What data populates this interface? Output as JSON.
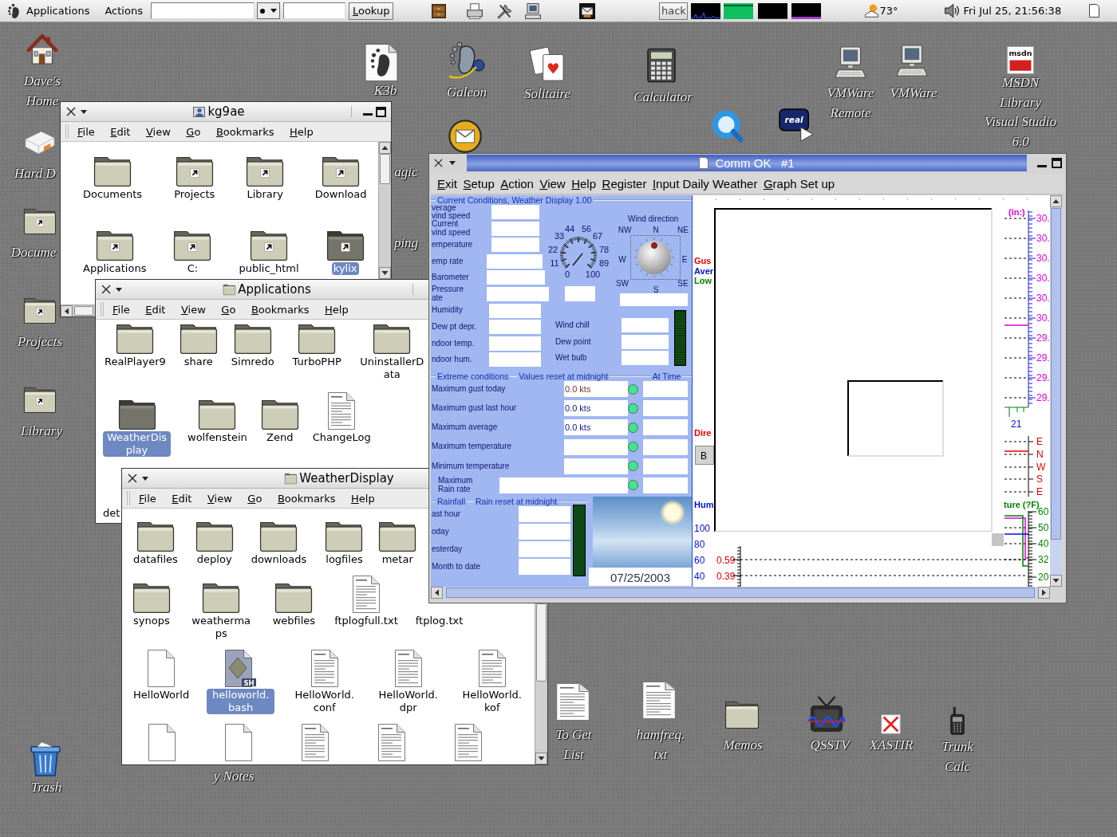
{
  "top_panel": {
    "menus": [
      "Applications",
      "Actions"
    ],
    "lookup_button": "Lookup",
    "hack_button": "hack",
    "temperature": "73°",
    "clock": "Fri Jul 25, 21:56:38"
  },
  "desktop_icons": [
    {
      "label": "Dave's Home",
      "kind": "home"
    },
    {
      "label": "Hard D",
      "kind": "drive"
    },
    {
      "label": "Docume",
      "kind": "folder-link"
    },
    {
      "label": "Projects",
      "kind": "folder-link"
    },
    {
      "label": "Library",
      "kind": "folder-link"
    },
    {
      "label": "Trash",
      "kind": "trash"
    },
    {
      "label": "K3b",
      "kind": "footprint-doc"
    },
    {
      "label": "Galeon",
      "kind": "footprint"
    },
    {
      "label": "Solitaire",
      "kind": "cards"
    },
    {
      "label": "Calculator",
      "kind": "calculator"
    },
    {
      "label": "VMWare Remote",
      "kind": "computer"
    },
    {
      "label": "VMWare",
      "kind": "computer"
    },
    {
      "label": "MSDN Library Visual Studio 6.0",
      "kind": "logo",
      "badge": "msdn"
    },
    {
      "kind": "envelope"
    },
    {
      "kind": "ring"
    },
    {
      "kind": "player",
      "badge": "real"
    },
    {
      "label": "agic",
      "kind": "covered"
    },
    {
      "label": "ping",
      "kind": "covered"
    },
    {
      "label": "To Get List",
      "kind": "document"
    },
    {
      "label": "hamfreq.txt",
      "kind": "document"
    },
    {
      "label": "Memos",
      "kind": "folder"
    },
    {
      "label": "QSSTV",
      "kind": "tv"
    },
    {
      "label": "XASTIR",
      "kind": "cross"
    },
    {
      "label": "Trunk Calc",
      "kind": "radio"
    },
    {
      "label": "y Notes",
      "kind": "covered"
    }
  ],
  "file_windows": [
    {
      "title": "kg9ae",
      "menus": [
        "File",
        "Edit",
        "View",
        "Go",
        "Bookmarks",
        "Help"
      ],
      "items": [
        {
          "label": "Documents",
          "kind": "folder",
          "selected": false
        },
        {
          "label": "Projects",
          "kind": "folder-link",
          "selected": false
        },
        {
          "label": "Library",
          "kind": "folder-link",
          "selected": false
        },
        {
          "label": "Download",
          "kind": "folder-link",
          "selected": false
        },
        {
          "label": "Applications",
          "kind": "folder-link",
          "selected": false
        },
        {
          "label": "C:",
          "kind": "folder-link",
          "selected": false
        },
        {
          "label": "public_html",
          "kind": "folder-link",
          "selected": false
        },
        {
          "label": "kylix",
          "kind": "folder-link",
          "selected": true
        }
      ]
    },
    {
      "title": "Applications",
      "menus": [
        "File",
        "Edit",
        "View",
        "Go",
        "Bookmarks",
        "Help"
      ],
      "items": [
        {
          "label": "RealPlayer9",
          "kind": "folder",
          "selected": false
        },
        {
          "label": "share",
          "kind": "folder",
          "selected": false
        },
        {
          "label": "Simredo",
          "kind": "folder",
          "selected": false
        },
        {
          "label": "TurboPHP",
          "kind": "folder",
          "selected": false
        },
        {
          "label": "UninstallerData",
          "kind": "folder",
          "selected": false
        },
        {
          "label": "WeatherDisplay",
          "kind": "folder",
          "selected": true
        },
        {
          "label": "wolfenstein",
          "kind": "folder",
          "selected": false
        },
        {
          "label": "Zend",
          "kind": "folder",
          "selected": false
        },
        {
          "label": "ChangeLog",
          "kind": "document",
          "selected": false
        },
        {
          "label": "det",
          "kind": "covered",
          "selected": false
        }
      ]
    },
    {
      "title": "WeatherDisplay",
      "menus": [
        "File",
        "Edit",
        "View",
        "Go",
        "Bookmarks",
        "Help"
      ],
      "items": [
        {
          "label": "datafiles",
          "kind": "folder",
          "selected": false
        },
        {
          "label": "deploy",
          "kind": "folder",
          "selected": false
        },
        {
          "label": "downloads",
          "kind": "folder",
          "selected": false
        },
        {
          "label": "logfiles",
          "kind": "folder",
          "selected": false
        },
        {
          "label": "metar",
          "kind": "folder",
          "selected": false
        },
        {
          "label": "synops",
          "kind": "folder",
          "selected": false
        },
        {
          "label": "weathermaps",
          "kind": "folder",
          "selected": false
        },
        {
          "label": "webfiles",
          "kind": "folder",
          "selected": false
        },
        {
          "label": "ftplogfull.txt",
          "kind": "document",
          "selected": false
        },
        {
          "label": "ftplog.txt",
          "kind": "covered",
          "selected": false
        },
        {
          "label": "HelloWorld",
          "kind": "blank",
          "selected": false
        },
        {
          "label": "helloworld.bash",
          "kind": "script",
          "badge": "SH",
          "selected": true
        },
        {
          "label": "HelloWorld.conf",
          "kind": "document",
          "selected": false
        },
        {
          "label": "HelloWorld.dpr",
          "kind": "document",
          "selected": false
        },
        {
          "label": "HelloWorld.kof",
          "kind": "document",
          "selected": false
        },
        {
          "kind": "blank",
          "selected": false
        },
        {
          "kind": "blank",
          "selected": false
        },
        {
          "kind": "document",
          "selected": false
        },
        {
          "kind": "document",
          "selected": false
        },
        {
          "kind": "document",
          "selected": false
        }
      ]
    }
  ],
  "weather_window": {
    "title": "Comm OK   #1",
    "menus": [
      "Exit",
      "Setup",
      "Action",
      "View",
      "Help",
      "Register",
      "Input Daily Weather",
      "Graph Set up"
    ],
    "current": {
      "legend": "Current Conditions, Weather Display 1.00",
      "rows": [
        "verage\nvind speed",
        "Current\nvind speed",
        "emperature",
        "emp rate",
        "Barometer",
        "Pressure\nate",
        "Humidity",
        "Dew pt depr.",
        "ndoor temp.",
        "ndoor hum."
      ],
      "gauge_labels": [
        "44",
        "56",
        "33",
        "67",
        "22",
        "78",
        "11",
        "89",
        "0",
        "100"
      ],
      "side_rows": [
        "Wind chill",
        "Dew point",
        "Wet bulb"
      ],
      "direction_title": "Wind direction",
      "compass": [
        "NW",
        "N",
        "NE",
        "W",
        "E",
        "SW",
        "S",
        "SE"
      ]
    },
    "extremes": {
      "legend": "Extreme conditions",
      "note": "Values reset at midnight",
      "time_legend": "At Time",
      "rows": [
        {
          "label": "Maximum gust today",
          "value": "0.0 kts",
          "color": "#7a3232"
        },
        {
          "label": "Maximum gust last hour",
          "value": "0.0 kts",
          "color": "#14208c"
        },
        {
          "label": "Maximum average",
          "value": "0.0 kts",
          "color": "#14208c"
        },
        {
          "label": "Maximum temperature"
        },
        {
          "label": "Minimum temperature"
        },
        {
          "label": "Maximum\nRain rate"
        }
      ]
    },
    "rainfall": {
      "legend": "Rainfall",
      "note": "Rain reset at midnight",
      "rows": [
        "ast hour",
        "oday",
        "esterday",
        "Month to date"
      ],
      "date": "07/25/2003"
    },
    "graph": {
      "unit": "(in:)",
      "legend": [
        {
          "label": "Gus",
          "color": "#e00000"
        },
        {
          "label": "Aver",
          "color": "#0010d0"
        },
        {
          "label": "Low",
          "color": "#008000"
        }
      ],
      "direction_label": "Dire",
      "button": "B",
      "humidity_label": "Hum",
      "humidity_ticks": [
        "100",
        "80",
        "60",
        "40"
      ],
      "rain_ticks": [
        "0.59",
        "0.39"
      ],
      "barometer_ticks": [
        "30.",
        "30.",
        "30.",
        "30.",
        "30.",
        "30.",
        "29.",
        "29.",
        "29.",
        "29."
      ],
      "hour_tick": "21",
      "direction_ticks": [
        "E",
        "N",
        "W",
        "S",
        "E"
      ],
      "temperature_label": "ture (?F)",
      "temperature_ticks": [
        "60",
        "50",
        "40",
        "32",
        "20"
      ]
    }
  }
}
